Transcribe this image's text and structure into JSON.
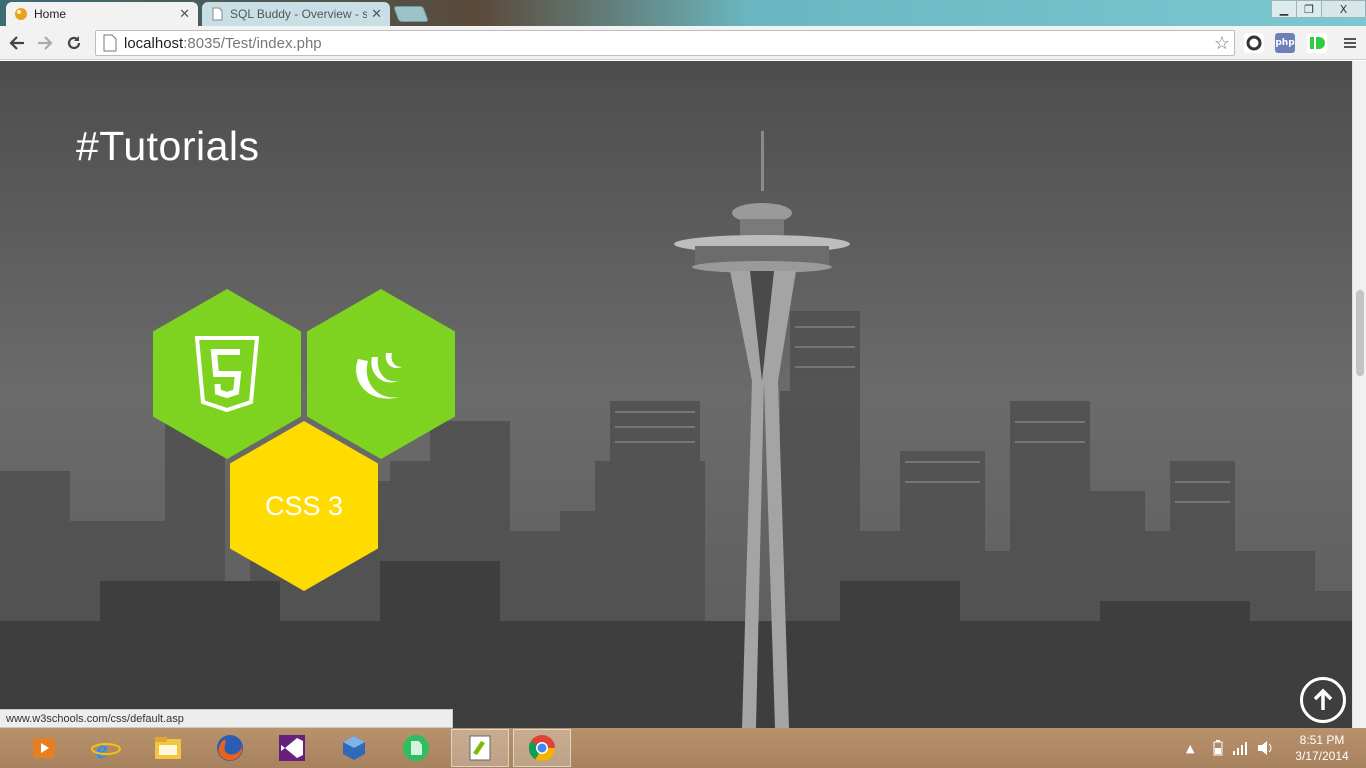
{
  "browser": {
    "tabs": [
      {
        "title": "Home",
        "active": true
      },
      {
        "title": "SQL Buddy - Overview - sp",
        "active": false
      }
    ],
    "url_host": "localhost",
    "url_path": ":8035/Test/index.php",
    "window_controls": {
      "minimize": "▁",
      "maximize": "❐",
      "close": "X"
    },
    "extensions": [
      "php"
    ]
  },
  "page": {
    "title": "#Tutorials",
    "tiles": [
      {
        "name": "html5",
        "color": "#7ed321"
      },
      {
        "name": "jquery",
        "color": "#7ed321"
      },
      {
        "name": "css3",
        "label": "CSS 3",
        "color": "#ffdc00"
      }
    ],
    "status_url": "www.w3schools.com/css/default.asp"
  },
  "taskbar": {
    "apps": [
      "windows-media-player",
      "internet-explorer",
      "file-explorer",
      "firefox",
      "visual-studio",
      "virtualbox",
      "evernote",
      "notepad-plus-plus",
      "chrome"
    ],
    "time": "8:51 PM",
    "date": "3/17/2014"
  }
}
